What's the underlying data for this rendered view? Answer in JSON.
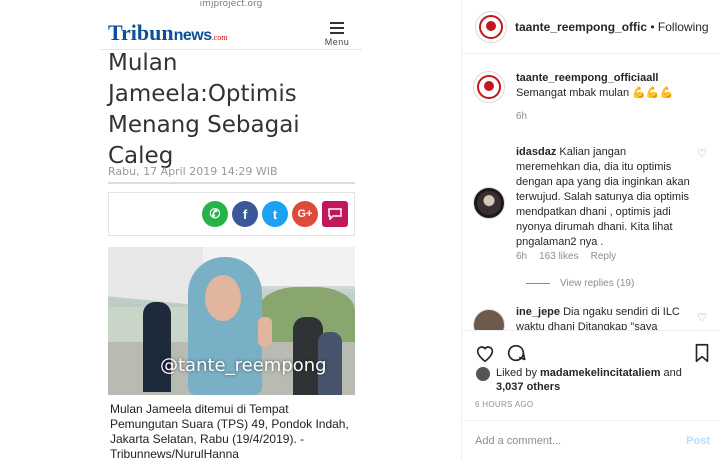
{
  "article": {
    "url_fragment": "imjproject.org",
    "logo_big": "Tribun",
    "logo_small": "news",
    "logo_tld": ".com",
    "menu_label": "Menu",
    "headline": "Mulan Jameela:Optimis Menang Sebagai Caleg",
    "date": "Rabu, 17 April 2019 14:29 WIB",
    "share": {
      "whatsapp": "✆",
      "facebook": "f",
      "twitter": "t",
      "google": "G+",
      "comment": "💬"
    },
    "watermark": "@tante_reempong",
    "caption": "Mulan Jameela ditemui di Tempat Pemungutan Suara (TPS) 49, Pondok Indah, Jakarta Selatan, Rabu (19/4/2019). - Tribunnews/NurulHanna"
  },
  "post": {
    "header_username": "taante_reempong_offic",
    "follow_sep": " • ",
    "follow_label": "Following",
    "comments": [
      {
        "username": "taante_reempong_officiaall",
        "text": "Semangat mbak mulan 💪💪💪",
        "time": "6h",
        "likes": "",
        "reply": ""
      },
      {
        "username": "idasdaz",
        "text": "Kalian jangan meremehkan dia, dia itu optimis dengan apa yang dia inginkan akan terwujud. Salah satunya dia optimis mendpatkan dhani , optimis jadi nyonya dirumah dhani. Kita lihat pngalaman2 nya .",
        "time": "6h",
        "likes": "163 likes",
        "reply": "Reply",
        "view_replies": "View replies (19)"
      },
      {
        "username": "ine_jepe",
        "text": "Dia ngaku sendiri di ILC waktu dhani Ditangkap \"saya",
        "time": "",
        "likes": "",
        "reply": ""
      }
    ],
    "liked_by_prefix": "Liked by ",
    "liked_by_user": "madamekelincitataliem",
    "liked_by_mid": " and ",
    "liked_by_count": "3,037 others",
    "timestamp": "6 HOURS AGO",
    "add_comment_placeholder": "Add a comment...",
    "post_button": "Post"
  },
  "colors": {
    "whatsapp": "#25b34a",
    "facebook": "#3b5998",
    "twitter": "#1da1f2",
    "google": "#dd4b39",
    "comment": "#c2185b",
    "brand_red": "#c4161c"
  }
}
